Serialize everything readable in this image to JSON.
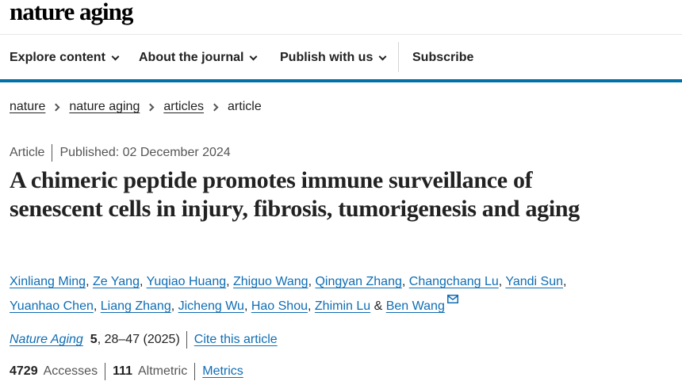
{
  "brand": {
    "logo": "nature aging"
  },
  "nav": {
    "items": [
      {
        "label": "Explore content"
      },
      {
        "label": "About the journal"
      },
      {
        "label": "Publish with us"
      }
    ],
    "subscribe": "Subscribe"
  },
  "breadcrumb": {
    "items": [
      "nature",
      "nature aging",
      "articles"
    ],
    "current": "article"
  },
  "article": {
    "type": "Article",
    "published": "Published: 02 December 2024",
    "title": "A chimeric peptide promotes immune surveillance of senescent cells in injury, fibrosis, tumorigenesis and aging",
    "authors": [
      "Xinliang Ming",
      "Ze Yang",
      "Yuqiao Huang",
      "Zhiguo Wang",
      "Qingyan Zhang",
      "Changchang Lu",
      "Yandi Sun",
      "Yuanhao Chen",
      "Liang Zhang",
      "Jicheng Wu",
      "Hao Shou",
      "Zhimin Lu",
      "Ben Wang"
    ],
    "author_and": "&",
    "citation": {
      "journal": "Nature Aging",
      "volume": "5",
      "pages_year": ", 28–47 (2025)",
      "cite_label": "Cite this article"
    },
    "metrics": {
      "accesses_value": "4729",
      "accesses_label": "Accesses",
      "altmetric_value": "111",
      "altmetric_label": "Altmetric",
      "metrics_link": "Metrics"
    }
  },
  "icons": {
    "mail": "mail-icon",
    "nav_chevron": "chevron-down-icon",
    "crumb_chevron": "chevron-right-icon"
  },
  "colors": {
    "link": "#0f6db4",
    "accent_bar": "#0070a8",
    "text": "#222222"
  }
}
